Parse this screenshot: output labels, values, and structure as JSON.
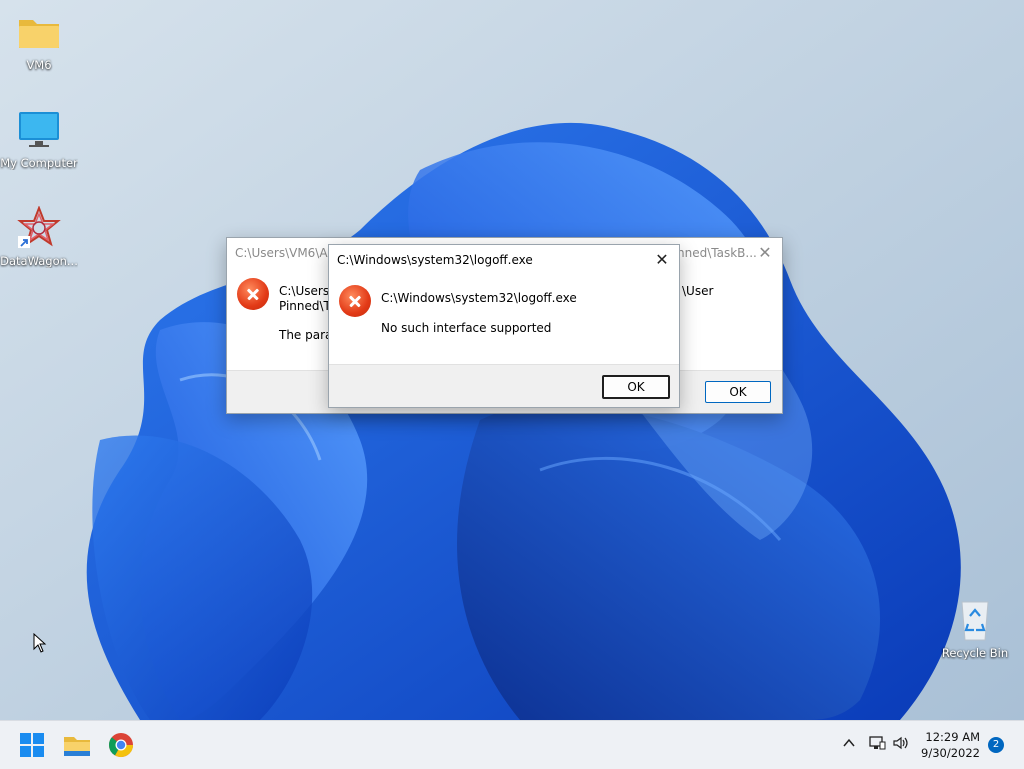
{
  "desktop": {
    "icons": [
      {
        "label": "VM6",
        "icon": "folder-icon"
      },
      {
        "label": "My Computer",
        "icon": "monitor-icon"
      },
      {
        "label": "DataWagon...",
        "icon": "datawagon-shortcut-icon"
      },
      {
        "label": "Recycle Bin",
        "icon": "recycle-bin-icon"
      }
    ]
  },
  "back_dialog": {
    "title_left": "C:\\Users\\VM6\\Ap",
    "title_right": "nned\\TaskB...",
    "message_line1_left": "C:\\Users\\",
    "message_line1_right": "\\User",
    "message_line2": "Pinned\\Ta",
    "message_line3": "The paran",
    "ok_label": "OK"
  },
  "front_dialog": {
    "title": "C:\\Windows\\system32\\logoff.exe",
    "message_path": "C:\\Windows\\system32\\logoff.exe",
    "message_text": "No such interface supported",
    "ok_label": "OK",
    "close_glyph": "✕"
  },
  "taskbar": {
    "pinned": [
      "start-icon",
      "file-explorer-icon",
      "chrome-icon"
    ],
    "time": "12:29 AM",
    "date": "9/30/2022",
    "notification_count": "2",
    "colors": {
      "accent": "#0067c0",
      "error": "#e23a17"
    }
  }
}
